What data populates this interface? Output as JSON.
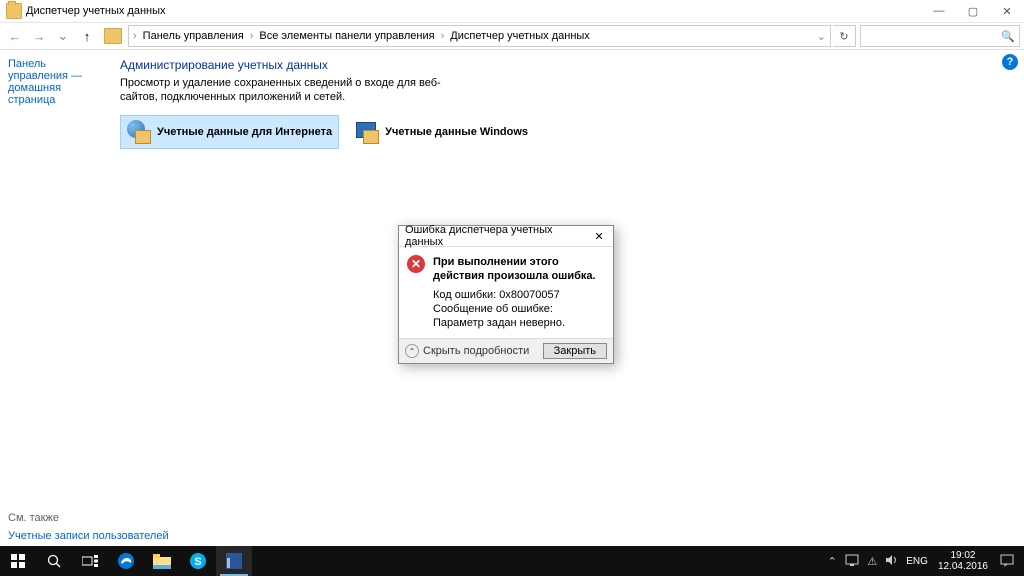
{
  "window": {
    "title": "Диспетчер учетных данных",
    "minimize": "—",
    "maximize": "▢",
    "close": "✕"
  },
  "nav": {
    "back": "←",
    "forward": "→",
    "up": "↑",
    "refresh": "↻",
    "search_icon": "🔍"
  },
  "breadcrumb": {
    "items": [
      "Панель управления",
      "Все элементы панели управления",
      "Диспетчер учетных данных"
    ],
    "sep": "›",
    "dropdown": "⌄"
  },
  "sidebar": {
    "home": "Панель управления — домашняя страница",
    "see_also": "См. также",
    "user_accounts": "Учетные записи пользователей"
  },
  "main": {
    "header": "Администрирование учетных данных",
    "desc": "Просмотр и удаление сохраненных сведений о входе для веб-сайтов, подключенных приложений и сетей.",
    "tile_web": "Учетные данные для Интернета",
    "tile_win": "Учетные данные Windows",
    "help": "?"
  },
  "dialog": {
    "title": "Ошибка диспетчера учетных данных",
    "close_x": "✕",
    "err_icon": "✕",
    "line1": "При выполнении этого действия произошла ошибка.",
    "line2": "Код ошибки: 0x80070057",
    "line3": "Сообщение об ошибке: Параметр задан неверно.",
    "details": "Скрыть подробности",
    "details_chev": "⌃",
    "close_btn": "Закрыть"
  },
  "taskbar": {
    "tray_up": "⌃",
    "tray_net": "⚠",
    "tray_vol": "🔊",
    "lang": "ENG",
    "time": "19:02",
    "date": "12.04.2016"
  }
}
